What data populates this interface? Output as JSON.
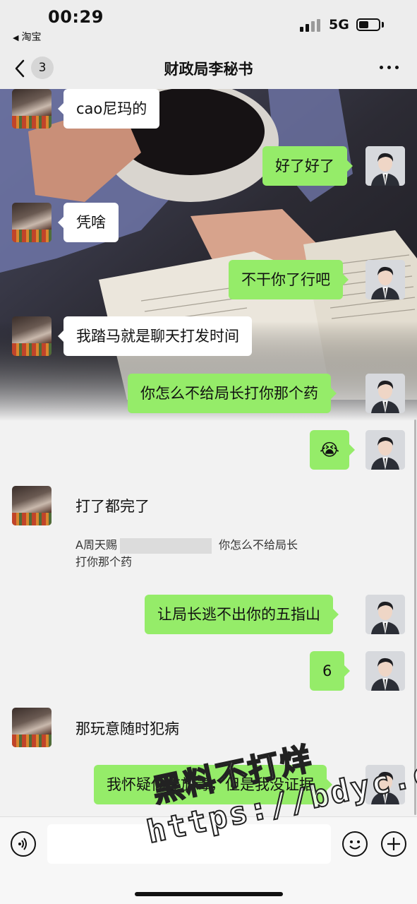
{
  "status_bar": {
    "time": "00:29",
    "back_app": "淘宝",
    "network": "5G",
    "battery_level": 0.4
  },
  "nav": {
    "unread_count": "3",
    "title": "财政局李秘书",
    "more_icon": "more-icon"
  },
  "messages": [
    {
      "side": "in",
      "text": "cao尼玛的"
    },
    {
      "side": "out",
      "text": "好了好了"
    },
    {
      "side": "in",
      "text": "凭啥"
    },
    {
      "side": "out",
      "text": "不干你了行吧"
    },
    {
      "side": "in",
      "text": "我踏马就是聊天打发时间"
    },
    {
      "side": "out",
      "text": "你怎么不给局长打你那个药"
    },
    {
      "side": "out",
      "text": "😭",
      "type": "emoji"
    },
    {
      "side": "in",
      "text": "打了都完了"
    },
    {
      "side": "out",
      "text": "让局长逃不出你的五指山"
    },
    {
      "side": "out",
      "text": "6"
    },
    {
      "side": "in",
      "text": "那玩意随时犯病"
    },
    {
      "side": "out",
      "text": "我怀疑你在放毒，但是我没证据"
    }
  ],
  "quote": {
    "name": "A周天赐",
    "line1_rest": "你怎么不给局长",
    "line2": "打你那个药"
  },
  "input_bar": {
    "voice_icon": "voice-icon",
    "emoji_icon": "emoji-icon",
    "plus_icon": "plus-icon"
  },
  "watermark": {
    "line1": "黑料不打烊",
    "line2": "https://bdyc.co"
  },
  "colors": {
    "outgoing_bubble": "#95ec69",
    "incoming_bubble": "#ffffff",
    "background": "#ededed"
  }
}
